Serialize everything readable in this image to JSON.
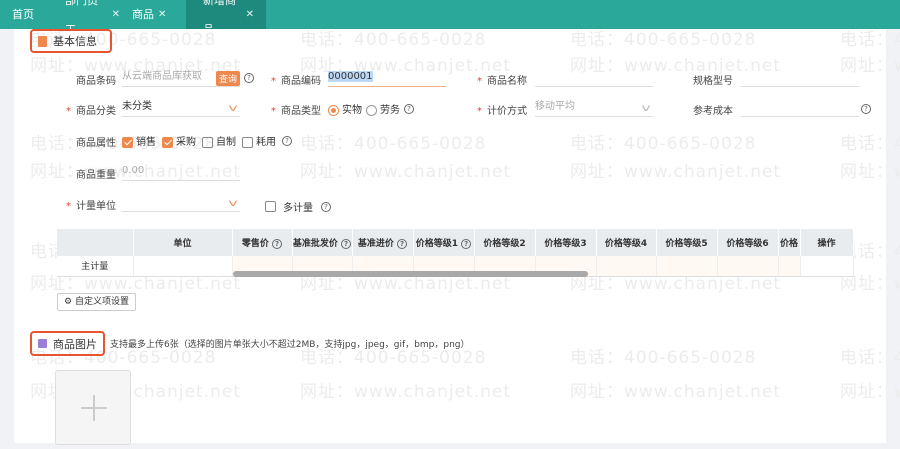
{
  "tabs": [
    {
      "label": "首页",
      "closable": false
    },
    {
      "label": "部门员工",
      "closable": true
    },
    {
      "label": "商品",
      "closable": true
    },
    {
      "label": "新增商品",
      "closable": true,
      "active": true
    }
  ],
  "watermark": {
    "phone": "电话：400-665-0028",
    "site": "网址：www.chanjet.net"
  },
  "basic": {
    "title": "基本信息",
    "barcode": {
      "label": "商品条码",
      "placeholder": "从云端商品库获取",
      "query": "查询"
    },
    "code": {
      "label": "商品编码",
      "value": "0000001"
    },
    "name": {
      "label": "商品名称",
      "value": ""
    },
    "spec": {
      "label": "规格型号",
      "value": ""
    },
    "category": {
      "label": "商品分类",
      "value": "未分类"
    },
    "type": {
      "label": "商品类型",
      "options": [
        "实物",
        "劳务"
      ],
      "selected": "实物"
    },
    "pricing": {
      "label": "计价方式",
      "value": "移动平均"
    },
    "refcost": {
      "label": "参考成本",
      "value": ""
    },
    "attrs": {
      "label": "商品属性",
      "options": [
        {
          "label": "销售",
          "checked": true
        },
        {
          "label": "采购",
          "checked": true
        },
        {
          "label": "自制",
          "checked": false
        },
        {
          "label": "耗用",
          "checked": false
        }
      ]
    },
    "weight": {
      "label": "商品重量",
      "placeholder": "0.00"
    },
    "unit": {
      "label": "计量单位",
      "value": ""
    },
    "multi": {
      "label": "多计量",
      "checked": false
    }
  },
  "unit_table": {
    "headers": [
      "",
      "单位",
      "零售价",
      "基准批发价",
      "基准进价",
      "价格等级1",
      "价格等级2",
      "价格等级3",
      "价格等级4",
      "价格等级5",
      "价格等级6",
      "价格",
      "操作"
    ],
    "rows": [
      [
        "主计量"
      ]
    ]
  },
  "custom_btn": "自定义项设置",
  "images": {
    "title": "商品图片",
    "hint": "支持最多上传6张（选择的图片单张大小不超过2MB，支持jpg，jpeg，gif，bmp，png）"
  },
  "colors": {
    "tabbar": "#2aa99a",
    "tab_active": "#1e8a7e",
    "accent": "#f0884e",
    "highlight": "#e8542d"
  }
}
